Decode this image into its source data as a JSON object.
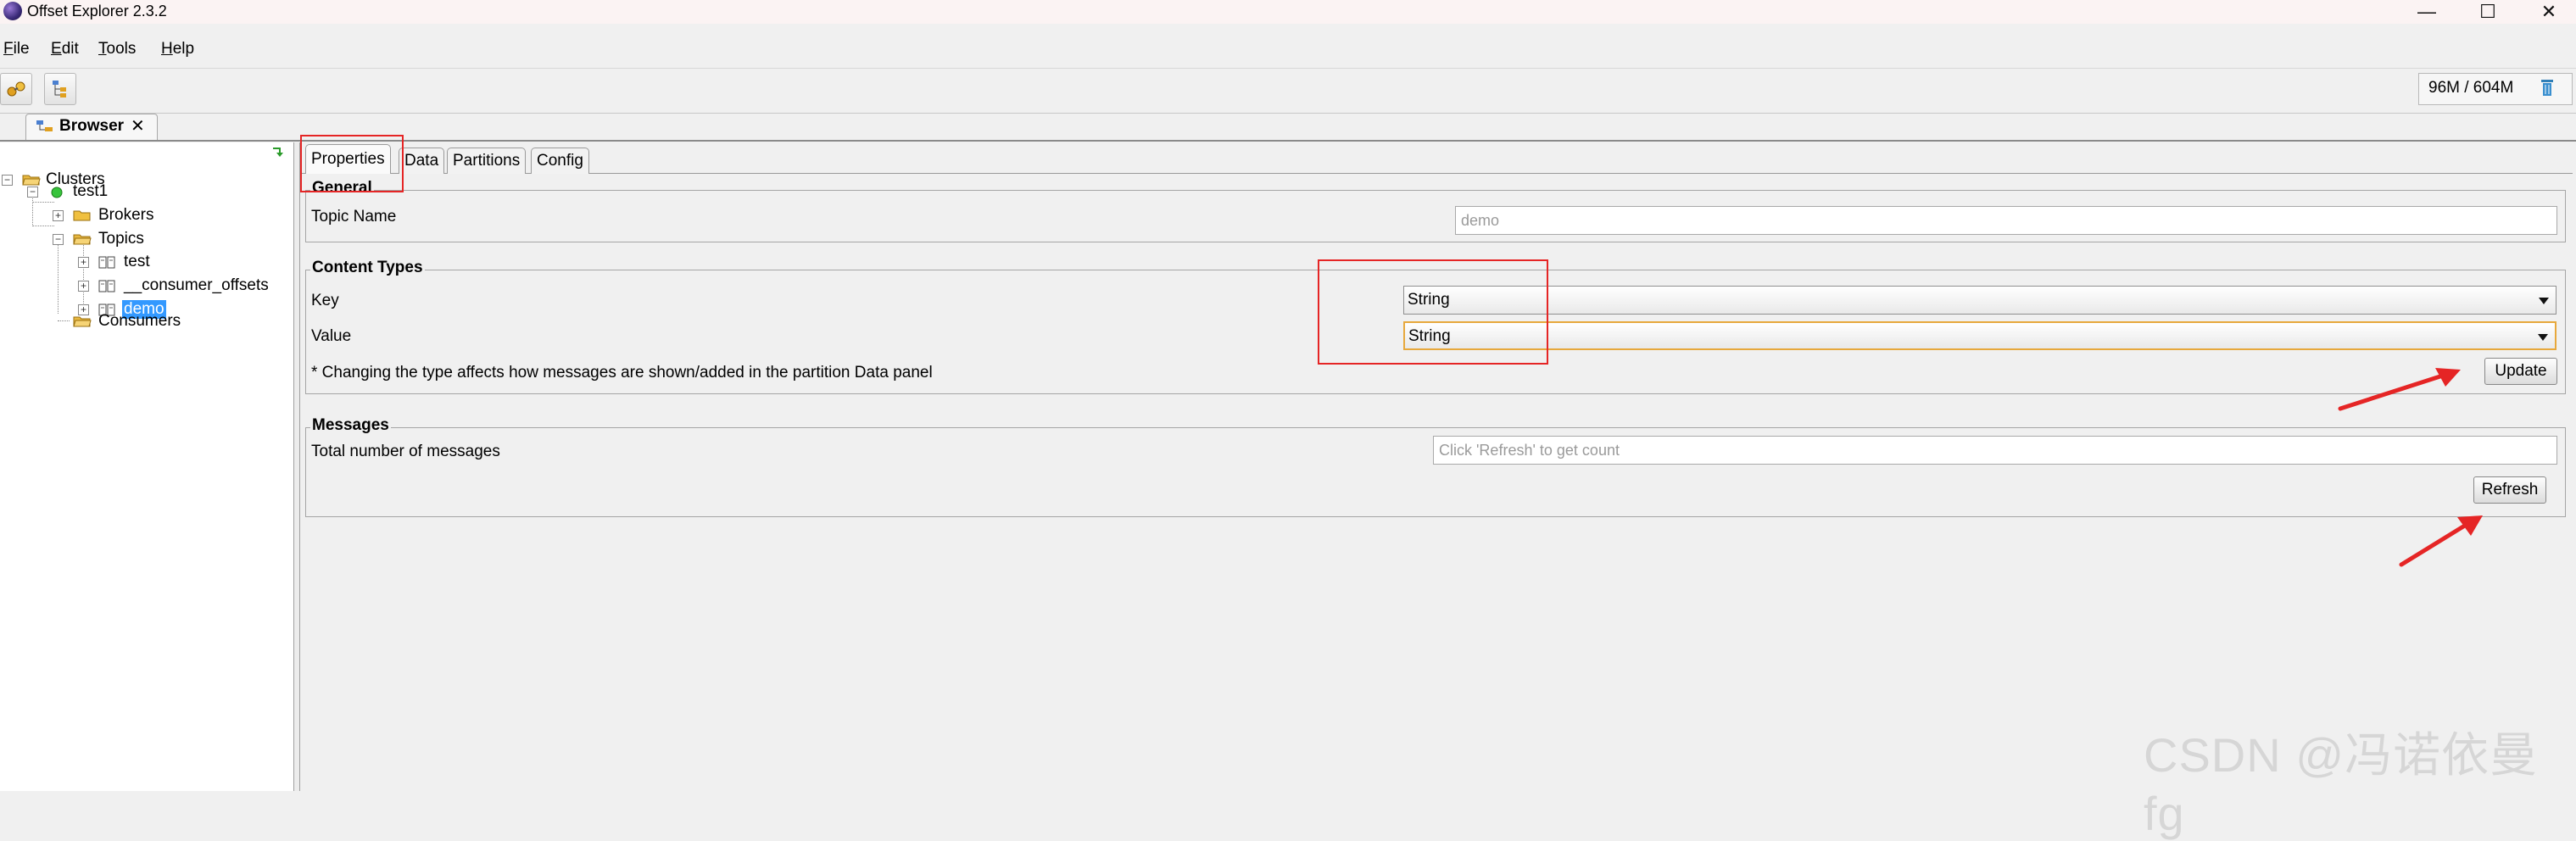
{
  "window": {
    "title": "Offset Explorer  2.3.2",
    "minimize_icon": "—",
    "maximize_icon": "☐",
    "close_icon": "✕"
  },
  "menu": [
    {
      "mnemonic": "F",
      "rest": "ile"
    },
    {
      "mnemonic": "E",
      "rest": "dit"
    },
    {
      "mnemonic": "T",
      "rest": "ools"
    },
    {
      "mnemonic": "H",
      "rest": "elp"
    }
  ],
  "toolbar": {
    "memory": "96M / 604M"
  },
  "doc_tab": {
    "label": "Browser",
    "close": "✕"
  },
  "tree": {
    "clusters": "Clusters",
    "cluster": "test1",
    "brokers": "Brokers",
    "topics": "Topics",
    "topic_items": [
      "test",
      "__consumer_offsets",
      "demo"
    ],
    "selected_topic": "demo",
    "consumers": "Consumers"
  },
  "tabs": [
    "Properties",
    "Data",
    "Partitions",
    "Config"
  ],
  "active_tab": "Properties",
  "general": {
    "title": "General",
    "topic_name_label": "Topic Name",
    "topic_name_value": "demo"
  },
  "content_types": {
    "title": "Content Types",
    "key_label": "Key",
    "key_value": "String",
    "value_label": "Value",
    "value_value": "String",
    "note": "* Changing the type affects how messages are shown/added in the partition Data panel",
    "update_button": "Update"
  },
  "messages": {
    "title": "Messages",
    "total_label": "Total number of messages",
    "total_placeholder": "Click 'Refresh' to get count",
    "refresh_button": "Refresh"
  },
  "watermark": "CSDN @冯诺依曼fg",
  "colors": {
    "annotation_red": "#e52525",
    "selection_blue": "#3399ff",
    "focus_orange": "#e7a83c"
  }
}
